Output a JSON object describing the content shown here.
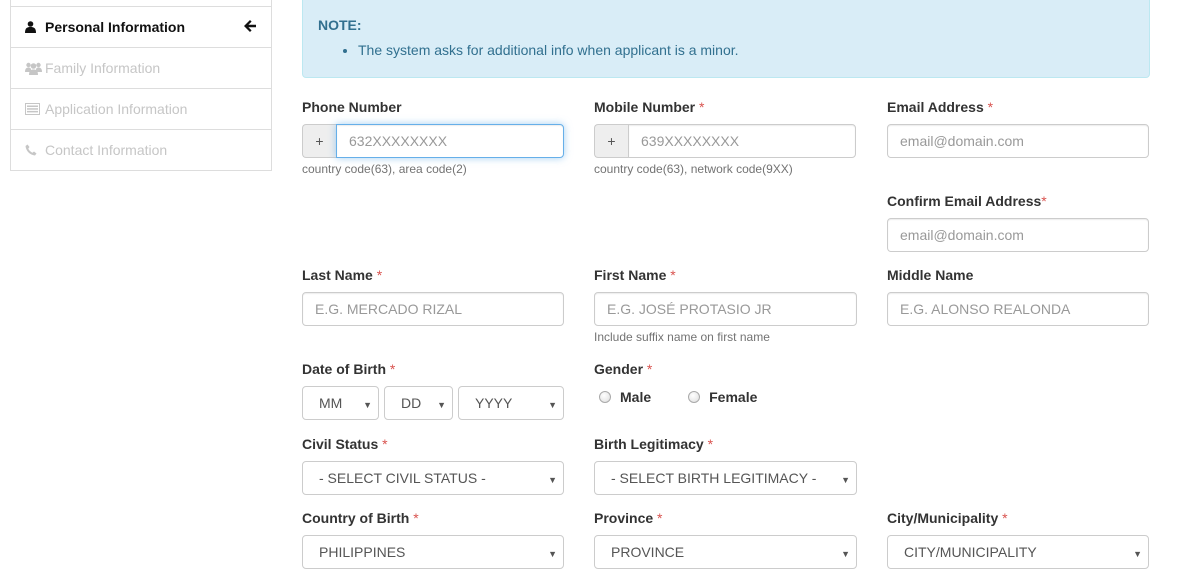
{
  "sidebar": {
    "items": [
      {
        "label": "Personal Information",
        "icon": "user-icon",
        "active": true
      },
      {
        "label": "Family Information",
        "icon": "users-icon",
        "active": false
      },
      {
        "label": "Application Information",
        "icon": "list-icon",
        "active": false
      },
      {
        "label": "Contact Information",
        "icon": "phone-icon",
        "active": false
      }
    ],
    "active_indicator_icon": "arrow-left-icon"
  },
  "note": {
    "title": "NOTE:",
    "items": [
      "The system asks for additional info when applicant is a minor."
    ]
  },
  "form": {
    "required_mark": "*",
    "phone": {
      "label": "Phone Number",
      "addon": "+",
      "placeholder": "632XXXXXXXX",
      "value": "",
      "help": "country code(63), area code(2)"
    },
    "mobile": {
      "label": "Mobile Number",
      "addon": "+",
      "placeholder": "639XXXXXXXX",
      "value": "",
      "help": "country code(63), network code(9XX)"
    },
    "email": {
      "label": "Email Address",
      "placeholder": "email@domain.com",
      "value": ""
    },
    "confirm_email": {
      "label": "Confirm Email Address",
      "placeholder": "email@domain.com",
      "value": ""
    },
    "last_name": {
      "label": "Last Name",
      "placeholder": "E.G. MERCADO RIZAL",
      "value": ""
    },
    "first_name": {
      "label": "First Name",
      "placeholder": "E.G. JOSÉ PROTASIO JR",
      "value": "",
      "help": "Include suffix name on first name"
    },
    "middle_name": {
      "label": "Middle Name",
      "placeholder": "E.G. ALONSO REALONDA",
      "value": ""
    },
    "dob": {
      "label": "Date of Birth",
      "month": "MM",
      "day": "DD",
      "year": "YYYY"
    },
    "gender": {
      "label": "Gender",
      "options": [
        "Male",
        "Female"
      ],
      "selected": null
    },
    "civil_status": {
      "label": "Civil Status",
      "selected": "- SELECT CIVIL STATUS -"
    },
    "birth_legitimacy": {
      "label": "Birth Legitimacy",
      "selected": "- SELECT BIRTH LEGITIMACY -"
    },
    "country_of_birth": {
      "label": "Country of Birth",
      "selected": "PHILIPPINES"
    },
    "province": {
      "label": "Province",
      "selected": "PROVINCE"
    },
    "city": {
      "label": "City/Municipality",
      "selected": "CITY/MUNICIPALITY"
    }
  },
  "colors": {
    "note_bg": "#d9edf7",
    "note_text": "#31708f",
    "required": "#d9534f",
    "focus_border": "#66afe9"
  }
}
